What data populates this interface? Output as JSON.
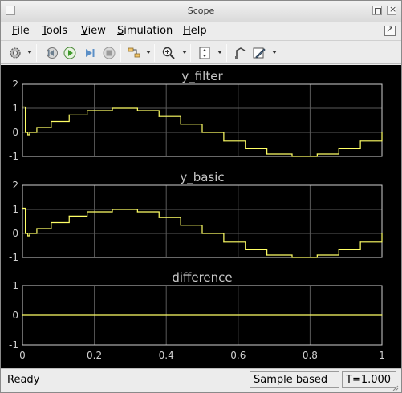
{
  "window": {
    "title": "Scope"
  },
  "menu": [
    {
      "label": "File",
      "underline": "F",
      "rest": "ile"
    },
    {
      "label": "Tools",
      "underline": "T",
      "rest": "ools"
    },
    {
      "label": "View",
      "underline": "V",
      "rest": "iew"
    },
    {
      "label": "Simulation",
      "underline": "S",
      "rest": "imulation"
    },
    {
      "label": "Help",
      "underline": "H",
      "rest": "elp"
    }
  ],
  "toolbar": {
    "icons": [
      "gear-icon",
      "step-back-icon",
      "run-icon",
      "step-forward-icon",
      "stop-icon",
      "highlight-signal-icon",
      "zoom-icon",
      "autoscale-icon",
      "measure-icon",
      "style-icon"
    ]
  },
  "status": {
    "left": "Ready",
    "mode": "Sample based",
    "time": "T=1.000"
  },
  "colors": {
    "background": "#000000",
    "grid": "#5a5a5a",
    "axes": "#d0d0d0",
    "signal": "#ffff66",
    "title": "#c8c8c8"
  },
  "chart_data": [
    {
      "type": "line",
      "title": "y_filter",
      "xlim": [
        0,
        1
      ],
      "ylim": [
        -1,
        2
      ],
      "xticks": [
        "0",
        "0.2",
        "0.4",
        "0.6",
        "0.8",
        "1"
      ],
      "yticks": [
        "-1",
        "0",
        "1",
        "2"
      ],
      "grid": true,
      "series": [
        {
          "x": [
            0,
            0.003,
            0.008,
            0.015,
            0.02,
            0.04,
            0.08,
            0.13,
            0.18,
            0.25,
            0.32,
            0.38,
            0.44,
            0.5,
            0.56,
            0.62,
            0.68,
            0.75,
            0.82,
            0.88,
            0.94,
            1.0
          ],
          "y": [
            1.05,
            1.05,
            0,
            -0.1,
            0,
            0.2,
            0.45,
            0.72,
            0.9,
            1.0,
            0.9,
            0.66,
            0.34,
            0,
            -0.36,
            -0.68,
            -0.9,
            -1.0,
            -0.9,
            -0.68,
            -0.36,
            0
          ]
        }
      ]
    },
    {
      "type": "line",
      "title": "y_basic",
      "xlim": [
        0,
        1
      ],
      "ylim": [
        -1,
        2
      ],
      "xticks": [
        "0",
        "0.2",
        "0.4",
        "0.6",
        "0.8",
        "1"
      ],
      "yticks": [
        "-1",
        "0",
        "1",
        "2"
      ],
      "grid": true,
      "series": [
        {
          "x": [
            0,
            0.003,
            0.008,
            0.015,
            0.02,
            0.04,
            0.08,
            0.13,
            0.18,
            0.25,
            0.32,
            0.38,
            0.44,
            0.5,
            0.56,
            0.62,
            0.68,
            0.75,
            0.82,
            0.88,
            0.94,
            1.0
          ],
          "y": [
            1.05,
            1.05,
            0,
            -0.1,
            0,
            0.2,
            0.45,
            0.72,
            0.9,
            1.0,
            0.9,
            0.66,
            0.34,
            0,
            -0.36,
            -0.68,
            -0.9,
            -1.0,
            -0.9,
            -0.68,
            -0.36,
            0
          ]
        }
      ]
    },
    {
      "type": "line",
      "title": "difference",
      "xlim": [
        0,
        1
      ],
      "ylim": [
        -1,
        1
      ],
      "xticks": [
        "0",
        "0.2",
        "0.4",
        "0.6",
        "0.8",
        "1"
      ],
      "yticks": [
        "-1",
        "0",
        "1"
      ],
      "grid": true,
      "series": [
        {
          "x": [
            0,
            1
          ],
          "y": [
            0,
            0
          ]
        }
      ]
    }
  ]
}
